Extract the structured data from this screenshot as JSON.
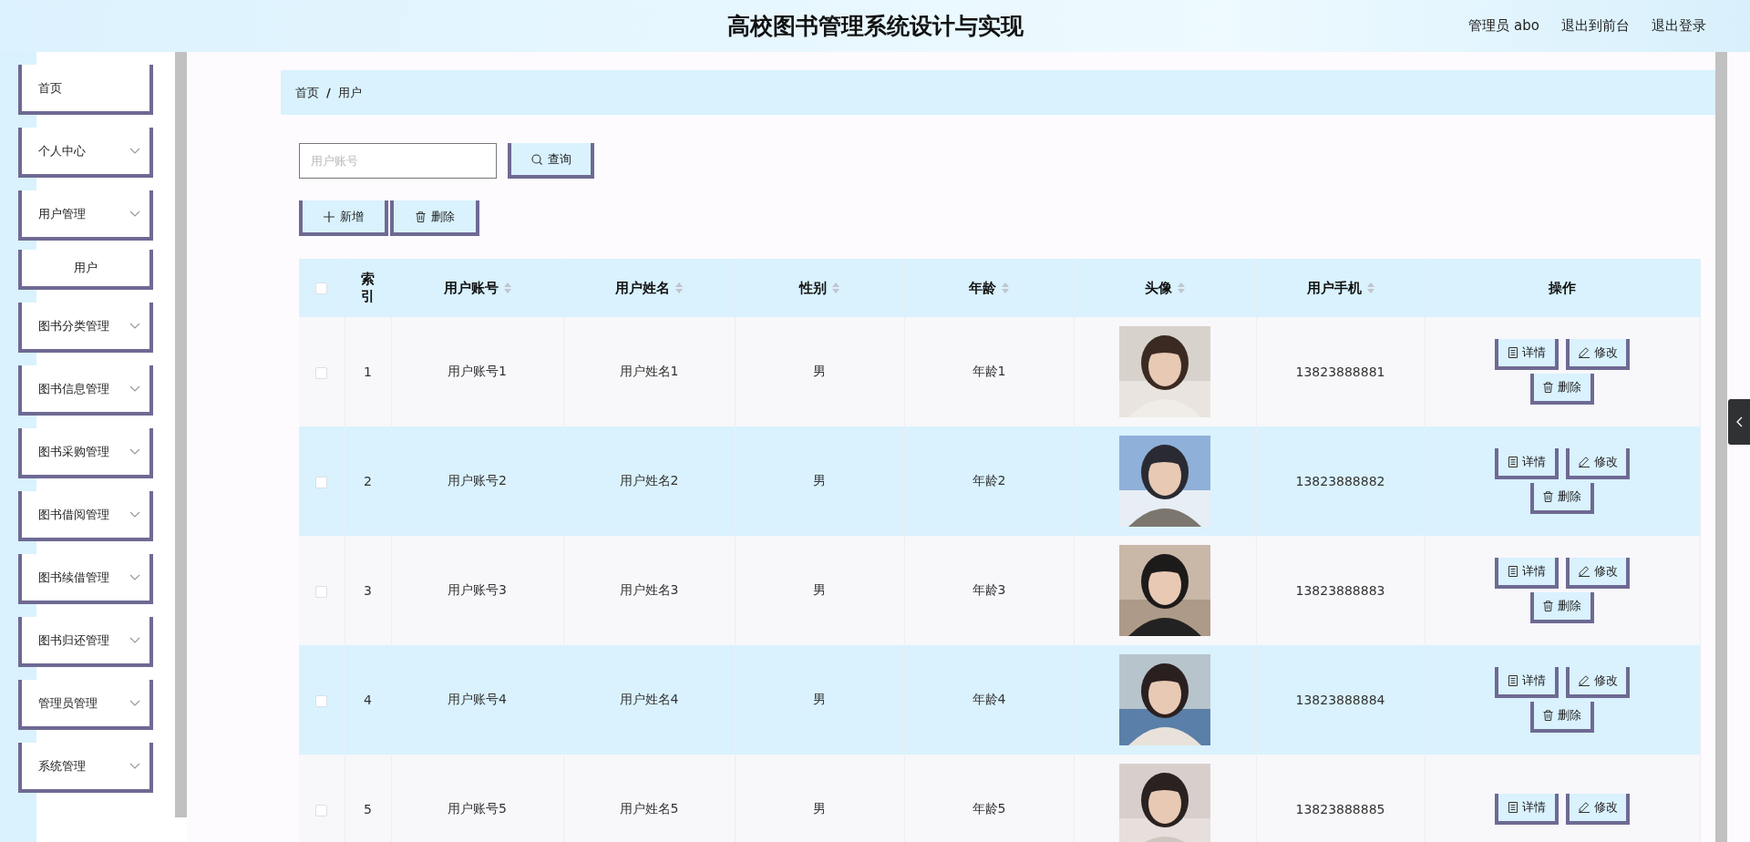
{
  "header": {
    "title": "高校图书管理系统设计与实现",
    "user": "管理员 abo",
    "links": [
      "退出到前台",
      "退出登录"
    ]
  },
  "sidebar": {
    "items": [
      {
        "label": "首页",
        "kind": "link"
      },
      {
        "label": "个人中心",
        "kind": "submenu"
      },
      {
        "label": "用户管理",
        "kind": "submenu",
        "children": [
          {
            "label": "用户"
          }
        ]
      },
      {
        "label": "图书分类管理",
        "kind": "submenu"
      },
      {
        "label": "图书信息管理",
        "kind": "submenu"
      },
      {
        "label": "图书采购管理",
        "kind": "submenu"
      },
      {
        "label": "图书借阅管理",
        "kind": "submenu"
      },
      {
        "label": "图书续借管理",
        "kind": "submenu"
      },
      {
        "label": "图书归还管理",
        "kind": "submenu"
      },
      {
        "label": "管理员管理",
        "kind": "submenu"
      },
      {
        "label": "系统管理",
        "kind": "submenu"
      }
    ]
  },
  "breadcrumb": {
    "items": [
      "首页",
      "用户"
    ],
    "separator": "/"
  },
  "search": {
    "placeholder": "用户账号",
    "button": "查询"
  },
  "toolbar": [
    {
      "label": "新增",
      "kind": "add"
    },
    {
      "label": "删除",
      "kind": "delete"
    }
  ],
  "table": {
    "all_selected": false,
    "columns": [
      {
        "label": "索引",
        "sortable": false
      },
      {
        "label": "用户账号",
        "sortable": true
      },
      {
        "label": "用户姓名",
        "sortable": true
      },
      {
        "label": "性别",
        "sortable": true
      },
      {
        "label": "年龄",
        "sortable": true
      },
      {
        "label": "头像",
        "sortable": true
      },
      {
        "label": "用户手机",
        "sortable": true
      },
      {
        "label": "操作",
        "sortable": false
      }
    ],
    "rows": [
      {
        "selected": false,
        "index": "1",
        "account": "用户账号1",
        "name": "用户姓名1",
        "gender": "男",
        "age": "年龄1",
        "avatar": {
          "kind": "picture"
        },
        "phone": "13823888881",
        "actions": [
          {
            "label": "详情",
            "kind": "detail"
          },
          {
            "label": "修改",
            "kind": "edit"
          },
          {
            "label": "删除",
            "kind": "delete"
          }
        ]
      },
      {
        "selected": false,
        "index": "2",
        "account": "用户账号2",
        "name": "用户姓名2",
        "gender": "男",
        "age": "年龄2",
        "avatar": {
          "kind": "picture"
        },
        "phone": "13823888882",
        "actions": [
          {
            "label": "详情",
            "kind": "detail"
          },
          {
            "label": "修改",
            "kind": "edit"
          },
          {
            "label": "删除",
            "kind": "delete"
          }
        ]
      },
      {
        "selected": false,
        "index": "3",
        "account": "用户账号3",
        "name": "用户姓名3",
        "gender": "男",
        "age": "年龄3",
        "avatar": {
          "kind": "picture"
        },
        "phone": "13823888883",
        "actions": [
          {
            "label": "详情",
            "kind": "detail"
          },
          {
            "label": "修改",
            "kind": "edit"
          },
          {
            "label": "删除",
            "kind": "delete"
          }
        ]
      },
      {
        "selected": false,
        "index": "4",
        "account": "用户账号4",
        "name": "用户姓名4",
        "gender": "男",
        "age": "年龄4",
        "avatar": {
          "kind": "picture"
        },
        "phone": "13823888884",
        "actions": [
          {
            "label": "详情",
            "kind": "detail"
          },
          {
            "label": "修改",
            "kind": "edit"
          },
          {
            "label": "删除",
            "kind": "delete"
          }
        ]
      },
      {
        "selected": false,
        "index": "5",
        "account": "用户账号5",
        "name": "用户姓名5",
        "gender": "男",
        "age": "年龄5",
        "avatar": {
          "kind": "picture"
        },
        "phone": "13823888885",
        "actions": [
          {
            "label": "详情",
            "kind": "detail"
          },
          {
            "label": "修改",
            "kind": "edit"
          }
        ]
      }
    ]
  }
}
